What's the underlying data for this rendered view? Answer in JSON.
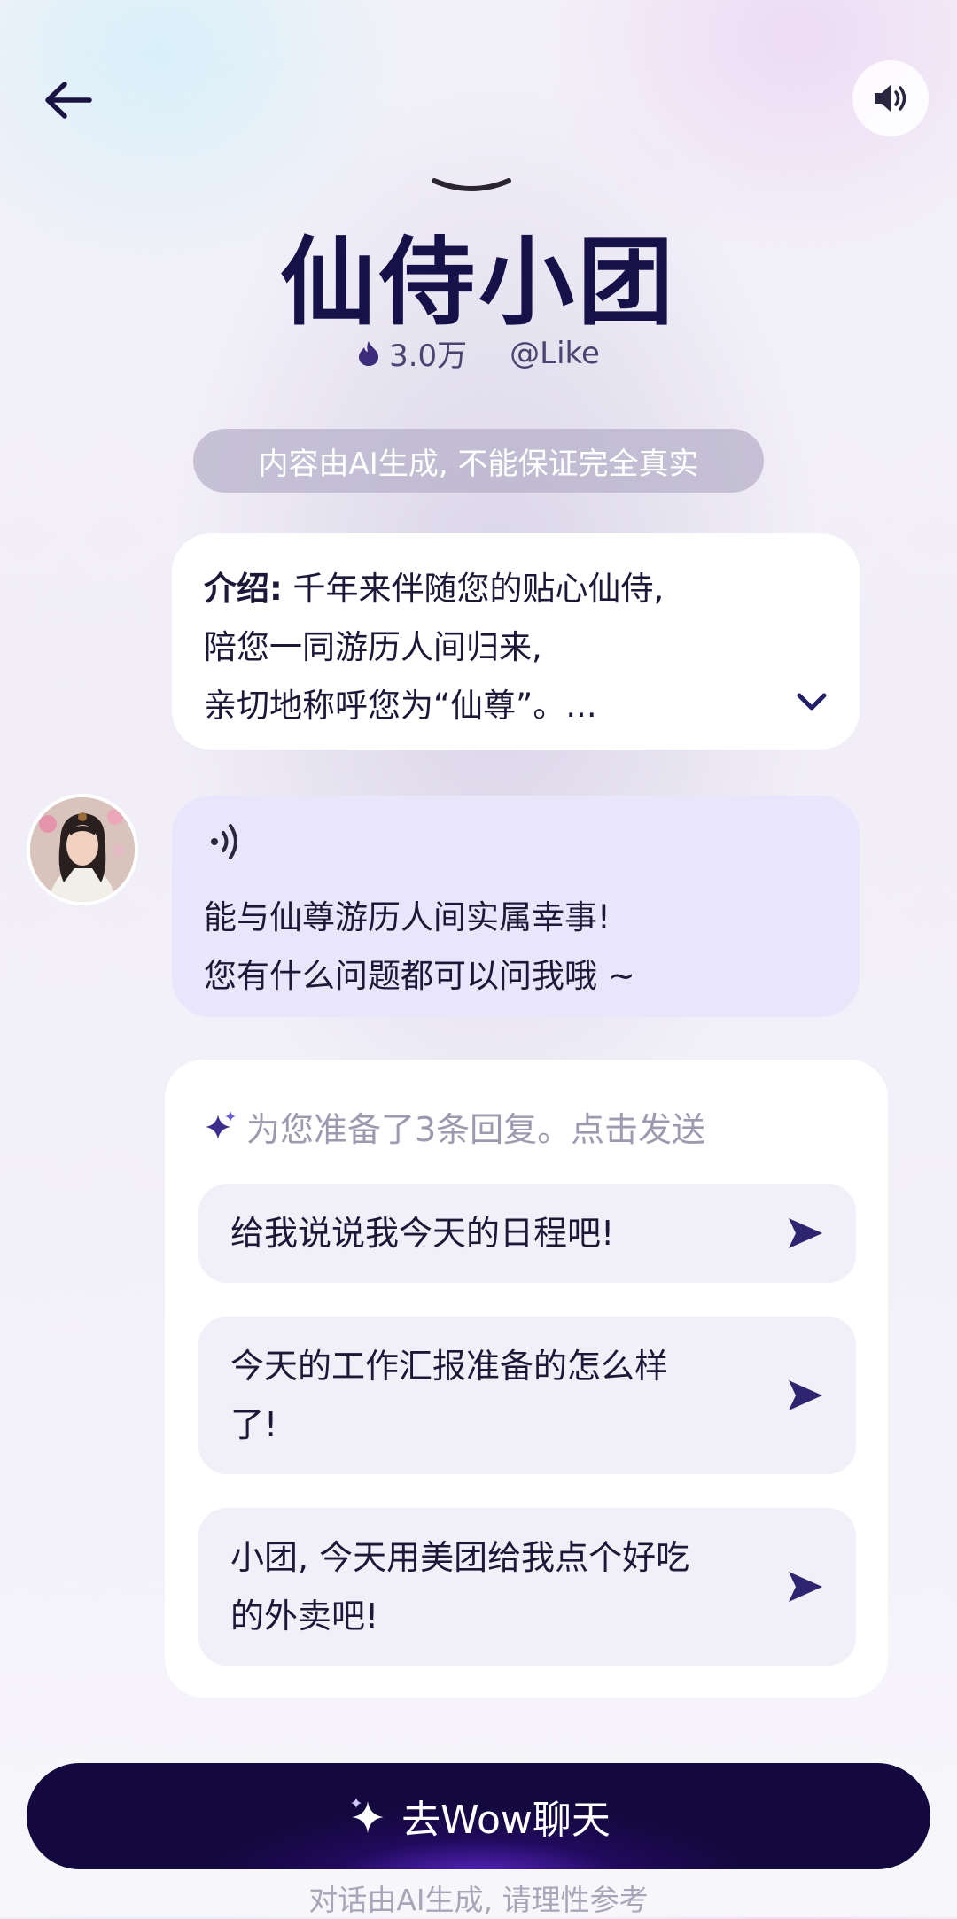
{
  "header": {
    "title": "仙侍小团",
    "heat": "3.0万",
    "author": "@Like",
    "disclaimer": "内容由AI生成, 不能保证完全真实"
  },
  "intro": {
    "label": "介绍:",
    "text_line1": " 千年来伴随您的贴心仙侍,",
    "text_line2": "陪您一同游历人间归来,",
    "text_line3": "亲切地称呼您为“仙尊”。..."
  },
  "bot_message": {
    "line1": "能与仙尊游历人间实属幸事!",
    "line2": "您有什么问题都可以问我哦 ~"
  },
  "suggestions": {
    "heading": "为您准备了3条回复。点击发送",
    "items": [
      {
        "line1": "给我说说我今天的日程吧!",
        "line2": ""
      },
      {
        "line1": "今天的工作汇报准备的怎么样",
        "line2": "了!"
      },
      {
        "line1": "小团, 今天用美团给我点个好吃",
        "line2": "的外卖吧!"
      }
    ]
  },
  "cta": {
    "label": "去Wow聊天"
  },
  "footnote": "对话由AI生成, 请理性参考",
  "icons": {
    "back": "arrow-left-icon",
    "sound": "speaker-icon",
    "heat": "flame-icon",
    "expand": "chevron-down-icon",
    "voice": "voice-wave-icon",
    "sparkle": "sparkle-icon",
    "send": "send-icon"
  },
  "colors": {
    "accent": "#2a1e6e",
    "cta_bg": "#14093f",
    "bubble_bg": "#e9e6fb"
  }
}
